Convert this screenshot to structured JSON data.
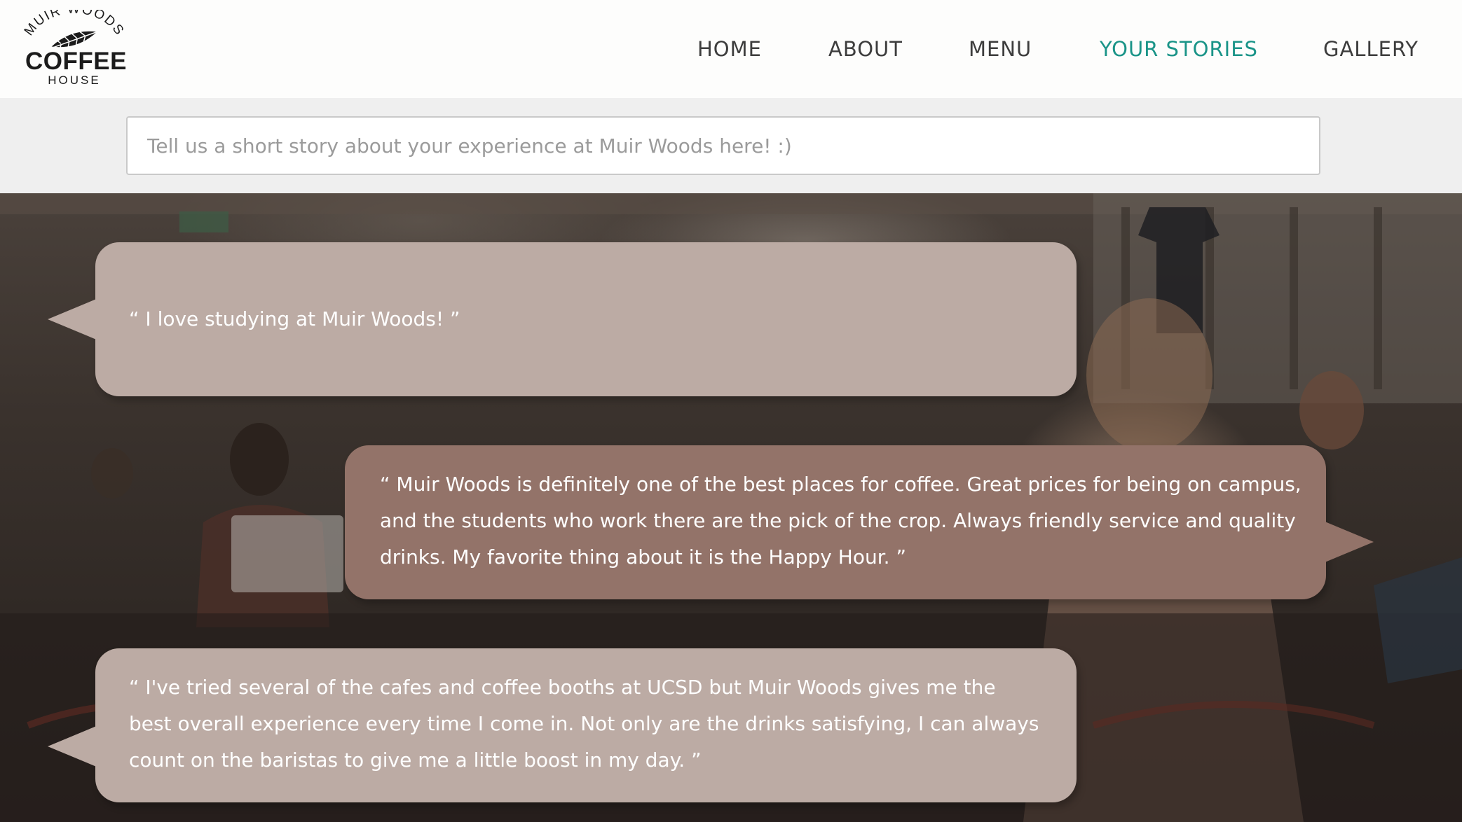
{
  "logo": {
    "arc_text": "MUIR WOODS",
    "main_text": "COFFEE",
    "sub_text": "HOUSE",
    "leaf_icon": "leaf-icon"
  },
  "nav": {
    "items": [
      {
        "label": "HOME"
      },
      {
        "label": "ABOUT"
      },
      {
        "label": "MENU"
      },
      {
        "label": "YOUR STORIES",
        "active": true
      },
      {
        "label": "GALLERY"
      }
    ],
    "active_color": "#1a9488",
    "color": "#3d3d3d"
  },
  "story_input": {
    "placeholder": "Tell us a short story about your experience at Muir Woods here! :)",
    "value": ""
  },
  "stories": [
    {
      "text": "“ I love studying at Muir Woods! ”",
      "color": "#bcaba4"
    },
    {
      "text": "“ Muir Woods is definitely one of the best places for coffee. Great prices for being on campus, and the students who work there are the pick of the crop. Always friendly service and quality drinks. My favorite thing about it is the Happy Hour.  ”",
      "color": "#937369"
    },
    {
      "text": "“ I've tried several of the cafes and coffee booths at UCSD but Muir Woods gives me the best overall experience every time I come in. Not only are the drinks satisfying, I can always count on the baristas to give me a little boost in my day. ”",
      "color": "#bcaba4"
    }
  ]
}
